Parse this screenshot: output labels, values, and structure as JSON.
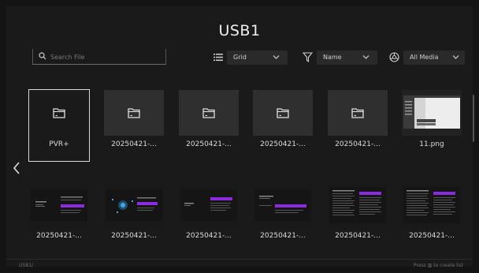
{
  "header": {
    "title": "USB1"
  },
  "search": {
    "placeholder": "Search File"
  },
  "toolbar": {
    "view_label": "Grid",
    "sort_label": "Name",
    "filter_label": "All Media"
  },
  "row1": [
    {
      "label": "PVR+",
      "type": "folder",
      "selected": true
    },
    {
      "label": "20250421-...",
      "type": "folder"
    },
    {
      "label": "20250421-...",
      "type": "folder"
    },
    {
      "label": "20250421-...",
      "type": "folder"
    },
    {
      "label": "20250421-...",
      "type": "folder"
    },
    {
      "label": "11.png",
      "type": "image"
    }
  ],
  "row2": [
    {
      "label": "20250421-...",
      "type": "image"
    },
    {
      "label": "20250421-...",
      "type": "image"
    },
    {
      "label": "20250421-...",
      "type": "image"
    },
    {
      "label": "20250421-...",
      "type": "image"
    },
    {
      "label": "20250421-...",
      "type": "image"
    },
    {
      "label": "20250421-...",
      "type": "image"
    }
  ],
  "footer": {
    "breadcrumb": "USB1/",
    "hint": "Press ▥ to create list"
  },
  "colors": {
    "background": "#1a1a1a",
    "tile": "#2f2f2f",
    "accent": "#8a2be2"
  }
}
